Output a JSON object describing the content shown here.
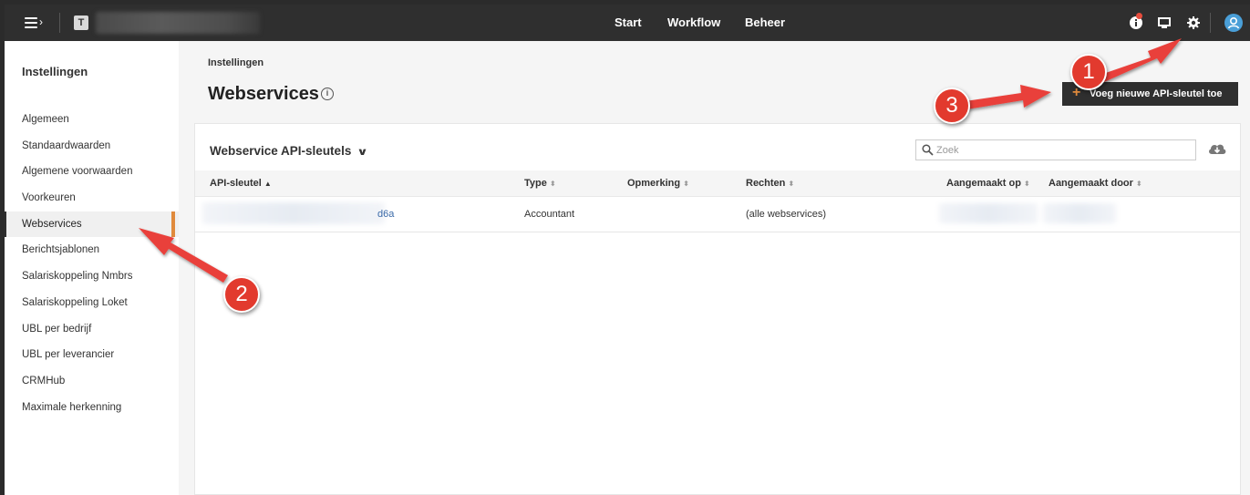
{
  "topbar": {
    "org_initial": "T",
    "nav": [
      "Start",
      "Workflow",
      "Beheer"
    ]
  },
  "sidebar": {
    "title": "Instellingen",
    "items": [
      {
        "label": "Algemeen"
      },
      {
        "label": "Standaardwaarden"
      },
      {
        "label": "Algemene voorwaarden"
      },
      {
        "label": "Voorkeuren"
      },
      {
        "label": "Webservices",
        "active": true
      },
      {
        "label": "Berichtsjablonen"
      },
      {
        "label": "Salariskoppeling Nmbrs"
      },
      {
        "label": "Salariskoppeling Loket"
      },
      {
        "label": "UBL per bedrijf"
      },
      {
        "label": "UBL per leverancier"
      },
      {
        "label": "CRMHub"
      },
      {
        "label": "Maximale herkenning"
      }
    ]
  },
  "main": {
    "breadcrumb": "Instellingen",
    "title": "Webservices",
    "add_button": "Voeg nieuwe API-sleutel toe",
    "panel": {
      "title": "Webservice API-sleutels",
      "search_placeholder": "Zoek",
      "columns": [
        "API-sleutel",
        "Type",
        "Opmerking",
        "Rechten",
        "Aangemaakt op",
        "Aangemaakt door"
      ],
      "rows": [
        {
          "api_key_suffix": "d6a",
          "type": "Accountant",
          "remark": "",
          "rights": "(alle webservices)"
        }
      ]
    }
  },
  "annotations": [
    "1",
    "2",
    "3"
  ],
  "colors": {
    "accent": "#e08a3c",
    "callout": "#e23a2e",
    "topbar": "#2f2f2f"
  }
}
